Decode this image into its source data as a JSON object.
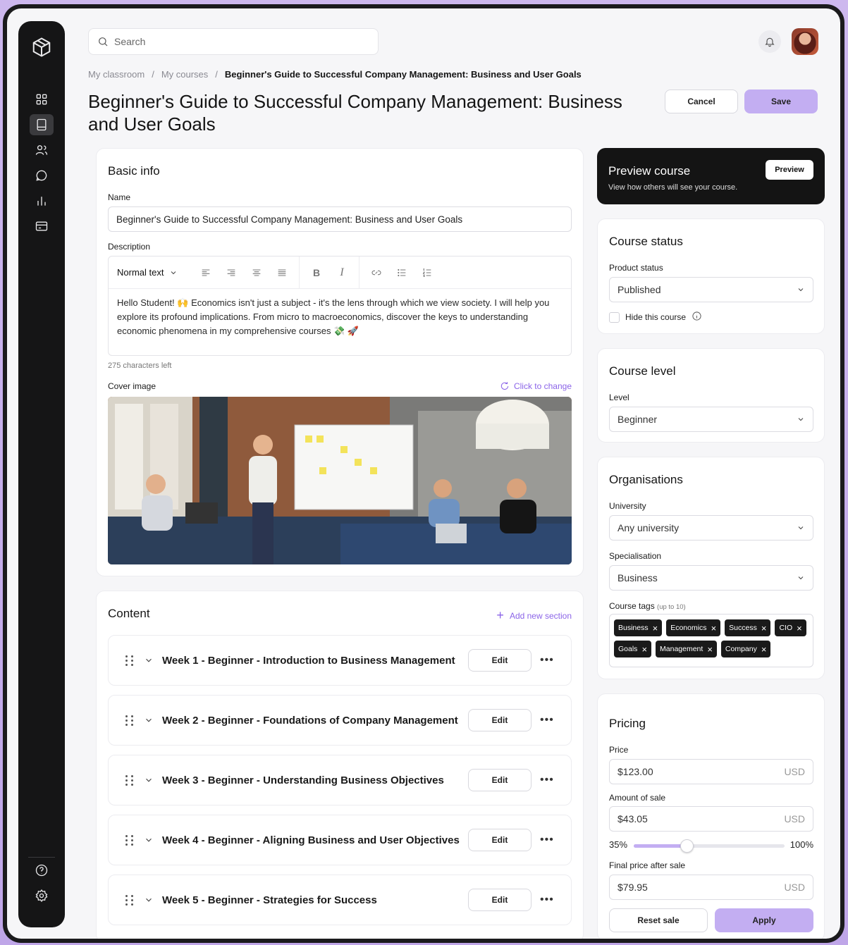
{
  "search": {
    "placeholder": "Search"
  },
  "breadcrumb": {
    "items": [
      "My classroom",
      "My courses"
    ],
    "current": "Beginner's Guide to Successful Company Management: Business and User Goals",
    "separator": "/"
  },
  "page": {
    "title": "Beginner's Guide to Successful Company Management: Business and User Goals",
    "cancel_label": "Cancel",
    "save_label": "Save"
  },
  "basic_info": {
    "title": "Basic info",
    "name_label": "Name",
    "name_value": "Beginner's Guide to Successful Company Management: Business and User Goals",
    "description_label": "Description",
    "text_style": "Normal text",
    "description_text": "Hello Student! 🙌 Economics isn't just a subject - it's the lens through which we view society. I will help you explore its profound implications. From micro to macroeconomics, discover the keys to understanding economic phenomena in my comprehensive courses 💸 🚀",
    "chars_left": "275 characters left",
    "cover_label": "Cover image",
    "change_label": "Click to change"
  },
  "content": {
    "title": "Content",
    "add_label": "Add new section",
    "edit_label": "Edit",
    "more_label": "•••",
    "sections": [
      {
        "title": "Week 1 - Beginner - Introduction to Business Management"
      },
      {
        "title": "Week 2 - Beginner - Foundations of Company Management"
      },
      {
        "title": "Week 3 - Beginner - Understanding Business Objectives"
      },
      {
        "title": "Week 4 - Beginner - Aligning Business and User Objectives"
      },
      {
        "title": "Week 5 - Beginner - Strategies for Success"
      }
    ]
  },
  "preview": {
    "title": "Preview course",
    "subtitle": "View how others will see your course.",
    "button_label": "Preview"
  },
  "course_status": {
    "title": "Course status",
    "product_status_label": "Product status",
    "product_status_value": "Published",
    "hide_label": "Hide this course"
  },
  "course_level": {
    "title": "Course level",
    "level_label": "Level",
    "level_value": "Beginner"
  },
  "organisations": {
    "title": "Organisations",
    "university_label": "University",
    "university_value": "Any university",
    "specialisation_label": "Specialisation",
    "specialisation_value": "Business",
    "tags_label": "Course tags",
    "tags_hint": "(up to 10)",
    "tags": [
      "Business",
      "Economics",
      "Success",
      "CIO",
      "Goals",
      "Management",
      "Company"
    ]
  },
  "pricing": {
    "title": "Pricing",
    "price_label": "Price",
    "price_value": "$123.00",
    "currency": "USD",
    "sale_label": "Amount of sale",
    "sale_value": "$43.05",
    "slider_min": "35%",
    "slider_max": "100%",
    "slider_fraction": 0.35,
    "final_label": "Final price after sale",
    "final_value": "$79.95",
    "reset_label": "Reset sale",
    "apply_label": "Apply"
  },
  "colors": {
    "accent": "#c3aef2",
    "accent_text": "#8b64e8",
    "sidebar": "#151516"
  }
}
